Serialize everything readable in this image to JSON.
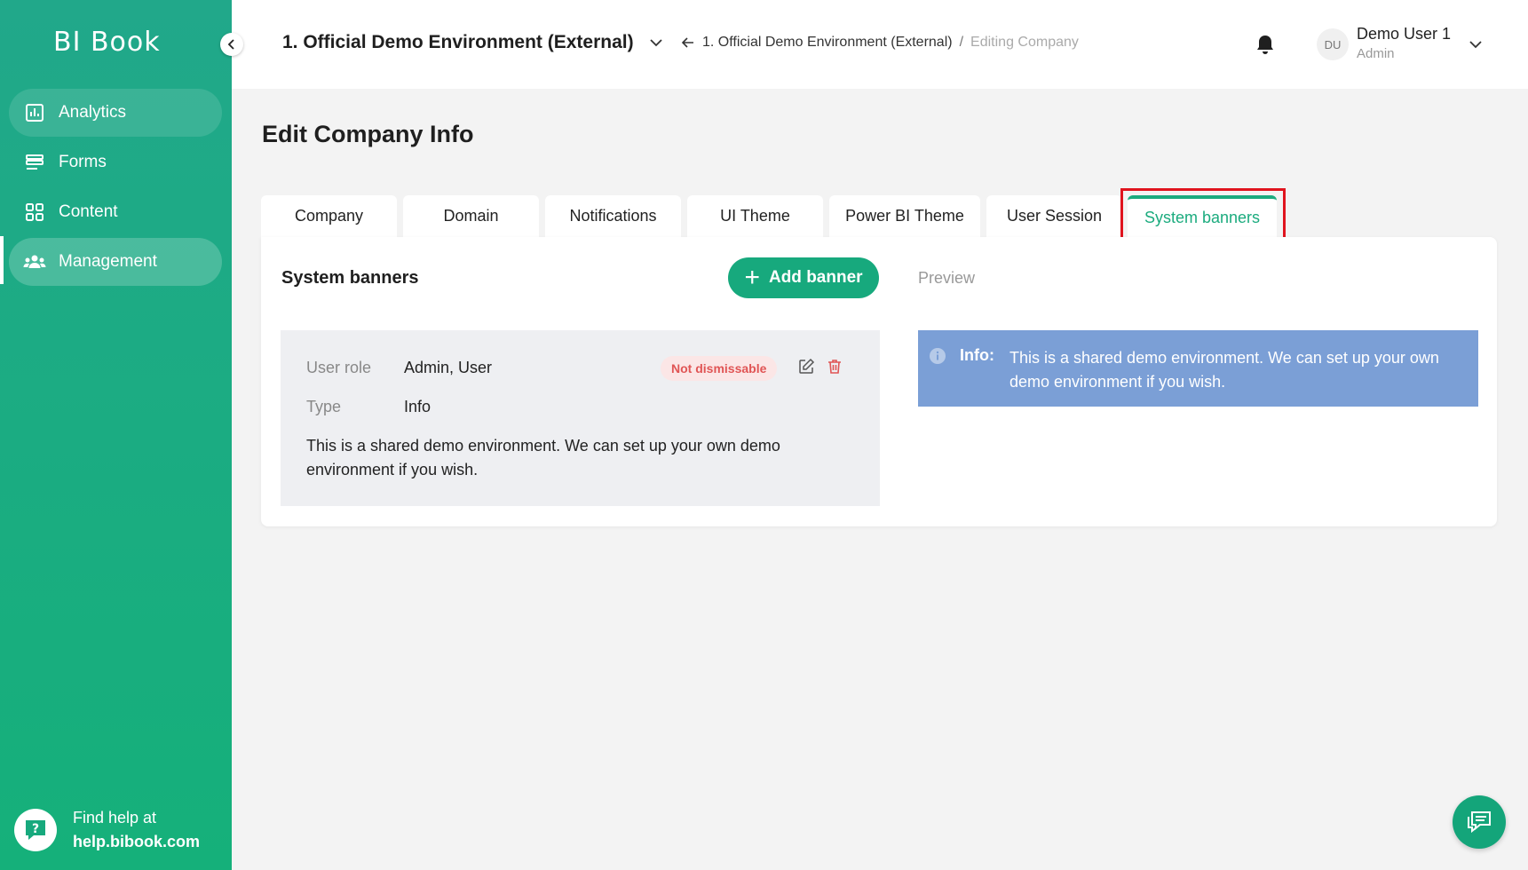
{
  "app": {
    "logo": "BI Book"
  },
  "sidebar": {
    "items": [
      {
        "label": "Analytics",
        "icon": "bar-chart-icon"
      },
      {
        "label": "Forms",
        "icon": "list-icon"
      },
      {
        "label": "Content",
        "icon": "grid-icon"
      },
      {
        "label": "Management",
        "icon": "users-icon"
      }
    ],
    "help": {
      "prefix": "Find help at",
      "link": "help.bibook.com"
    }
  },
  "header": {
    "environment": "1. Official Demo Environment (External)",
    "breadcrumb": {
      "parent": "1. Official Demo Environment (External)",
      "separator": "/",
      "current": "Editing Company"
    },
    "user": {
      "initials": "DU",
      "name": "Demo User 1",
      "role": "Admin"
    }
  },
  "page": {
    "title": "Edit Company Info",
    "tabs": [
      {
        "label": "Company"
      },
      {
        "label": "Domain"
      },
      {
        "label": "Notifications"
      },
      {
        "label": "UI Theme"
      },
      {
        "label": "Power BI Theme"
      },
      {
        "label": "User Session"
      },
      {
        "label": "System banners"
      }
    ],
    "active_tab": "System banners"
  },
  "system_banners": {
    "title": "System banners",
    "add_button": "Add banner",
    "preview_label": "Preview",
    "banner": {
      "user_role_label": "User role",
      "user_role_value": "Admin, User",
      "type_label": "Type",
      "type_value": "Info",
      "badge": "Not dismissable",
      "description": "This is a shared demo environment. We can set up your own demo environment if you wish."
    },
    "preview": {
      "label": "Info:",
      "text": "This is a shared demo environment. We can set up your own demo environment if you wish."
    }
  },
  "colors": {
    "primary": "#17a97d",
    "info_banner": "#7b9fd6",
    "danger": "#e05555",
    "highlight": "#e0141e"
  }
}
